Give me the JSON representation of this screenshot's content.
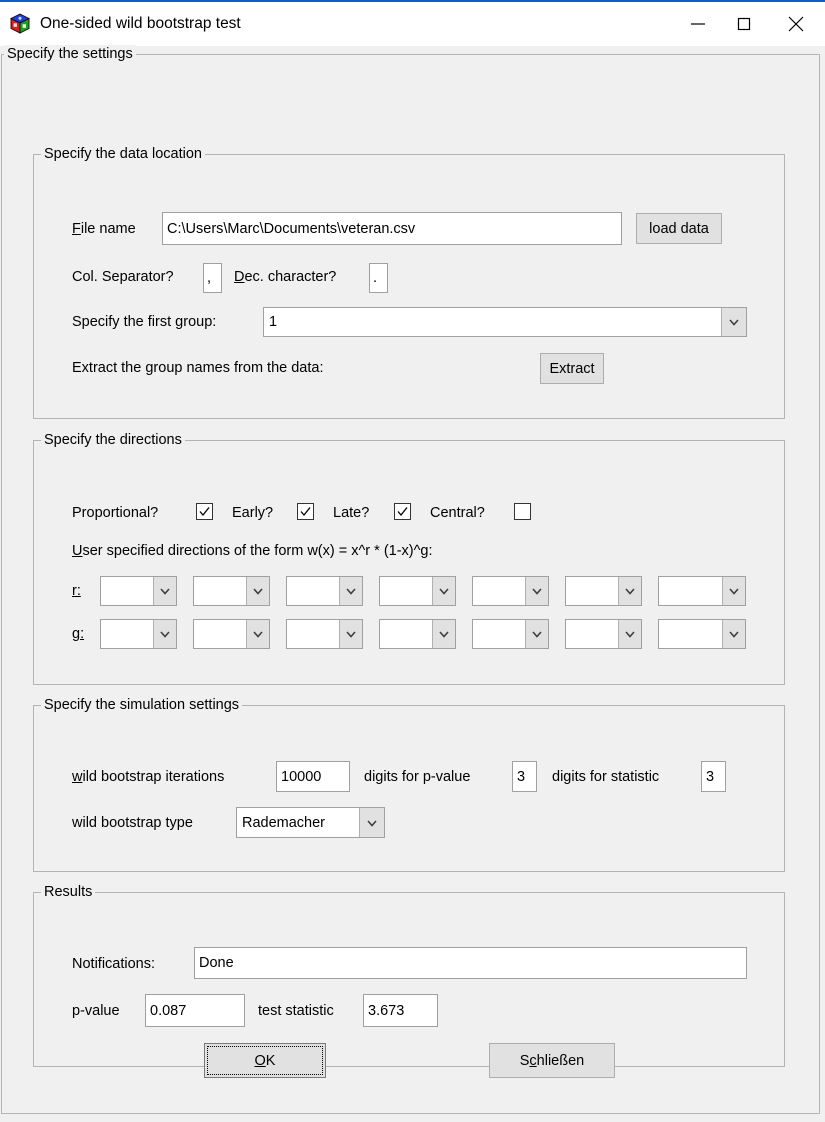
{
  "window": {
    "title": "One-sided wild bootstrap test",
    "icon": "rgb-cube-icon",
    "accent_color": "#0a64c8",
    "controls": {
      "minimize": "minimize-icon",
      "maximize": "maximize-icon",
      "close": "close-icon"
    }
  },
  "outer_frame": {
    "legend": "Specify the settings"
  },
  "data_location": {
    "legend": "Specify the data location",
    "file_name": {
      "label_pre": "F",
      "label_post": "ile name",
      "value": "C:\\Users\\Marc\\Documents\\veteran.csv"
    },
    "load_data_button": "load data",
    "col_separator": {
      "label_pre": "Col. S",
      "label_post": "eparator?",
      "value": ","
    },
    "dec_character": {
      "label_pre": "D",
      "label_post": "ec. character?",
      "value": "."
    },
    "first_group": {
      "label_a": "Specify the first ",
      "label_u": "g",
      "label_b": "roup:",
      "value": "1"
    },
    "extract": {
      "label_a": "Extract the ",
      "label_u": "g",
      "label_b": "roup names from the data:",
      "button": "Extract"
    }
  },
  "directions": {
    "legend": "Specify the directions",
    "checkboxes": [
      {
        "label": "Proportional?",
        "checked": true
      },
      {
        "label": "Early?",
        "checked": true
      },
      {
        "label": "Late?",
        "checked": true
      },
      {
        "label": "Central?",
        "checked": false
      }
    ],
    "user_directions_label_pre": "U",
    "user_directions_label_post": "ser specified directions of the form w(x) = x^r * (1-x)^g:",
    "row_r_label": "r:",
    "row_g_label": "g:",
    "r_values": [
      "",
      "",
      "",
      "",
      "",
      "",
      ""
    ],
    "g_values": [
      "",
      "",
      "",
      "",
      "",
      "",
      ""
    ]
  },
  "simulation": {
    "legend": "Specify the simulation settings",
    "iterations": {
      "label_pre": "w",
      "label_post": "ild bootstrap iterations",
      "value": "10000"
    },
    "digits_pvalue": {
      "label": "digits for p-value",
      "value": "3"
    },
    "digits_statistic": {
      "label": "digits for statistic",
      "value": "3"
    },
    "bootstrap_type": {
      "label": "wild bootstrap type",
      "value": "Rademacher"
    }
  },
  "results": {
    "legend": "Results",
    "notifications": {
      "label": "Notifications:",
      "value": "Done"
    },
    "p_value": {
      "label": "p-value",
      "value": "0.087"
    },
    "test_statistic": {
      "label": "test statistic",
      "value": "3.673"
    }
  },
  "footer": {
    "ok": {
      "pre": "O",
      "post": "K"
    },
    "close": {
      "a": "S",
      "u": "c",
      "b": "hließen"
    }
  }
}
